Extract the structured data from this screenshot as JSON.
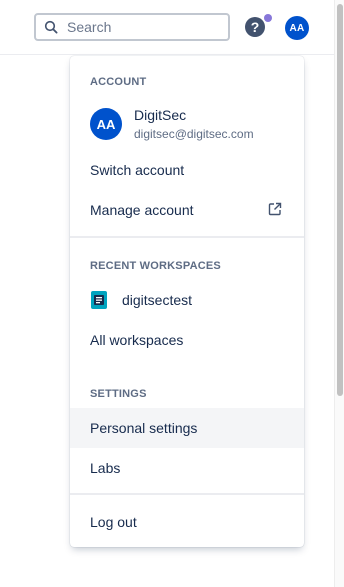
{
  "topbar": {
    "search_placeholder": "Search",
    "help_label": "?",
    "avatar_initials": "AA"
  },
  "menu": {
    "account_header": "ACCOUNT",
    "account": {
      "initials": "AA",
      "name": "DigitSec",
      "email": "digitsec@digitsec.com"
    },
    "switch_account": "Switch account",
    "manage_account": "Manage account",
    "recent_header": "RECENT WORKSPACES",
    "workspace_name": "digitsectest",
    "all_workspaces": "All workspaces",
    "settings_header": "SETTINGS",
    "personal_settings": "Personal settings",
    "labs": "Labs",
    "log_out": "Log out"
  },
  "colors": {
    "accent": "#0052cc",
    "notification_dot": "#8777d9",
    "workspace_icon": "#00a3bf"
  },
  "icons": {
    "search": "search-icon",
    "help": "question-icon",
    "external": "external-link-icon",
    "workspace": "workspace-icon"
  }
}
